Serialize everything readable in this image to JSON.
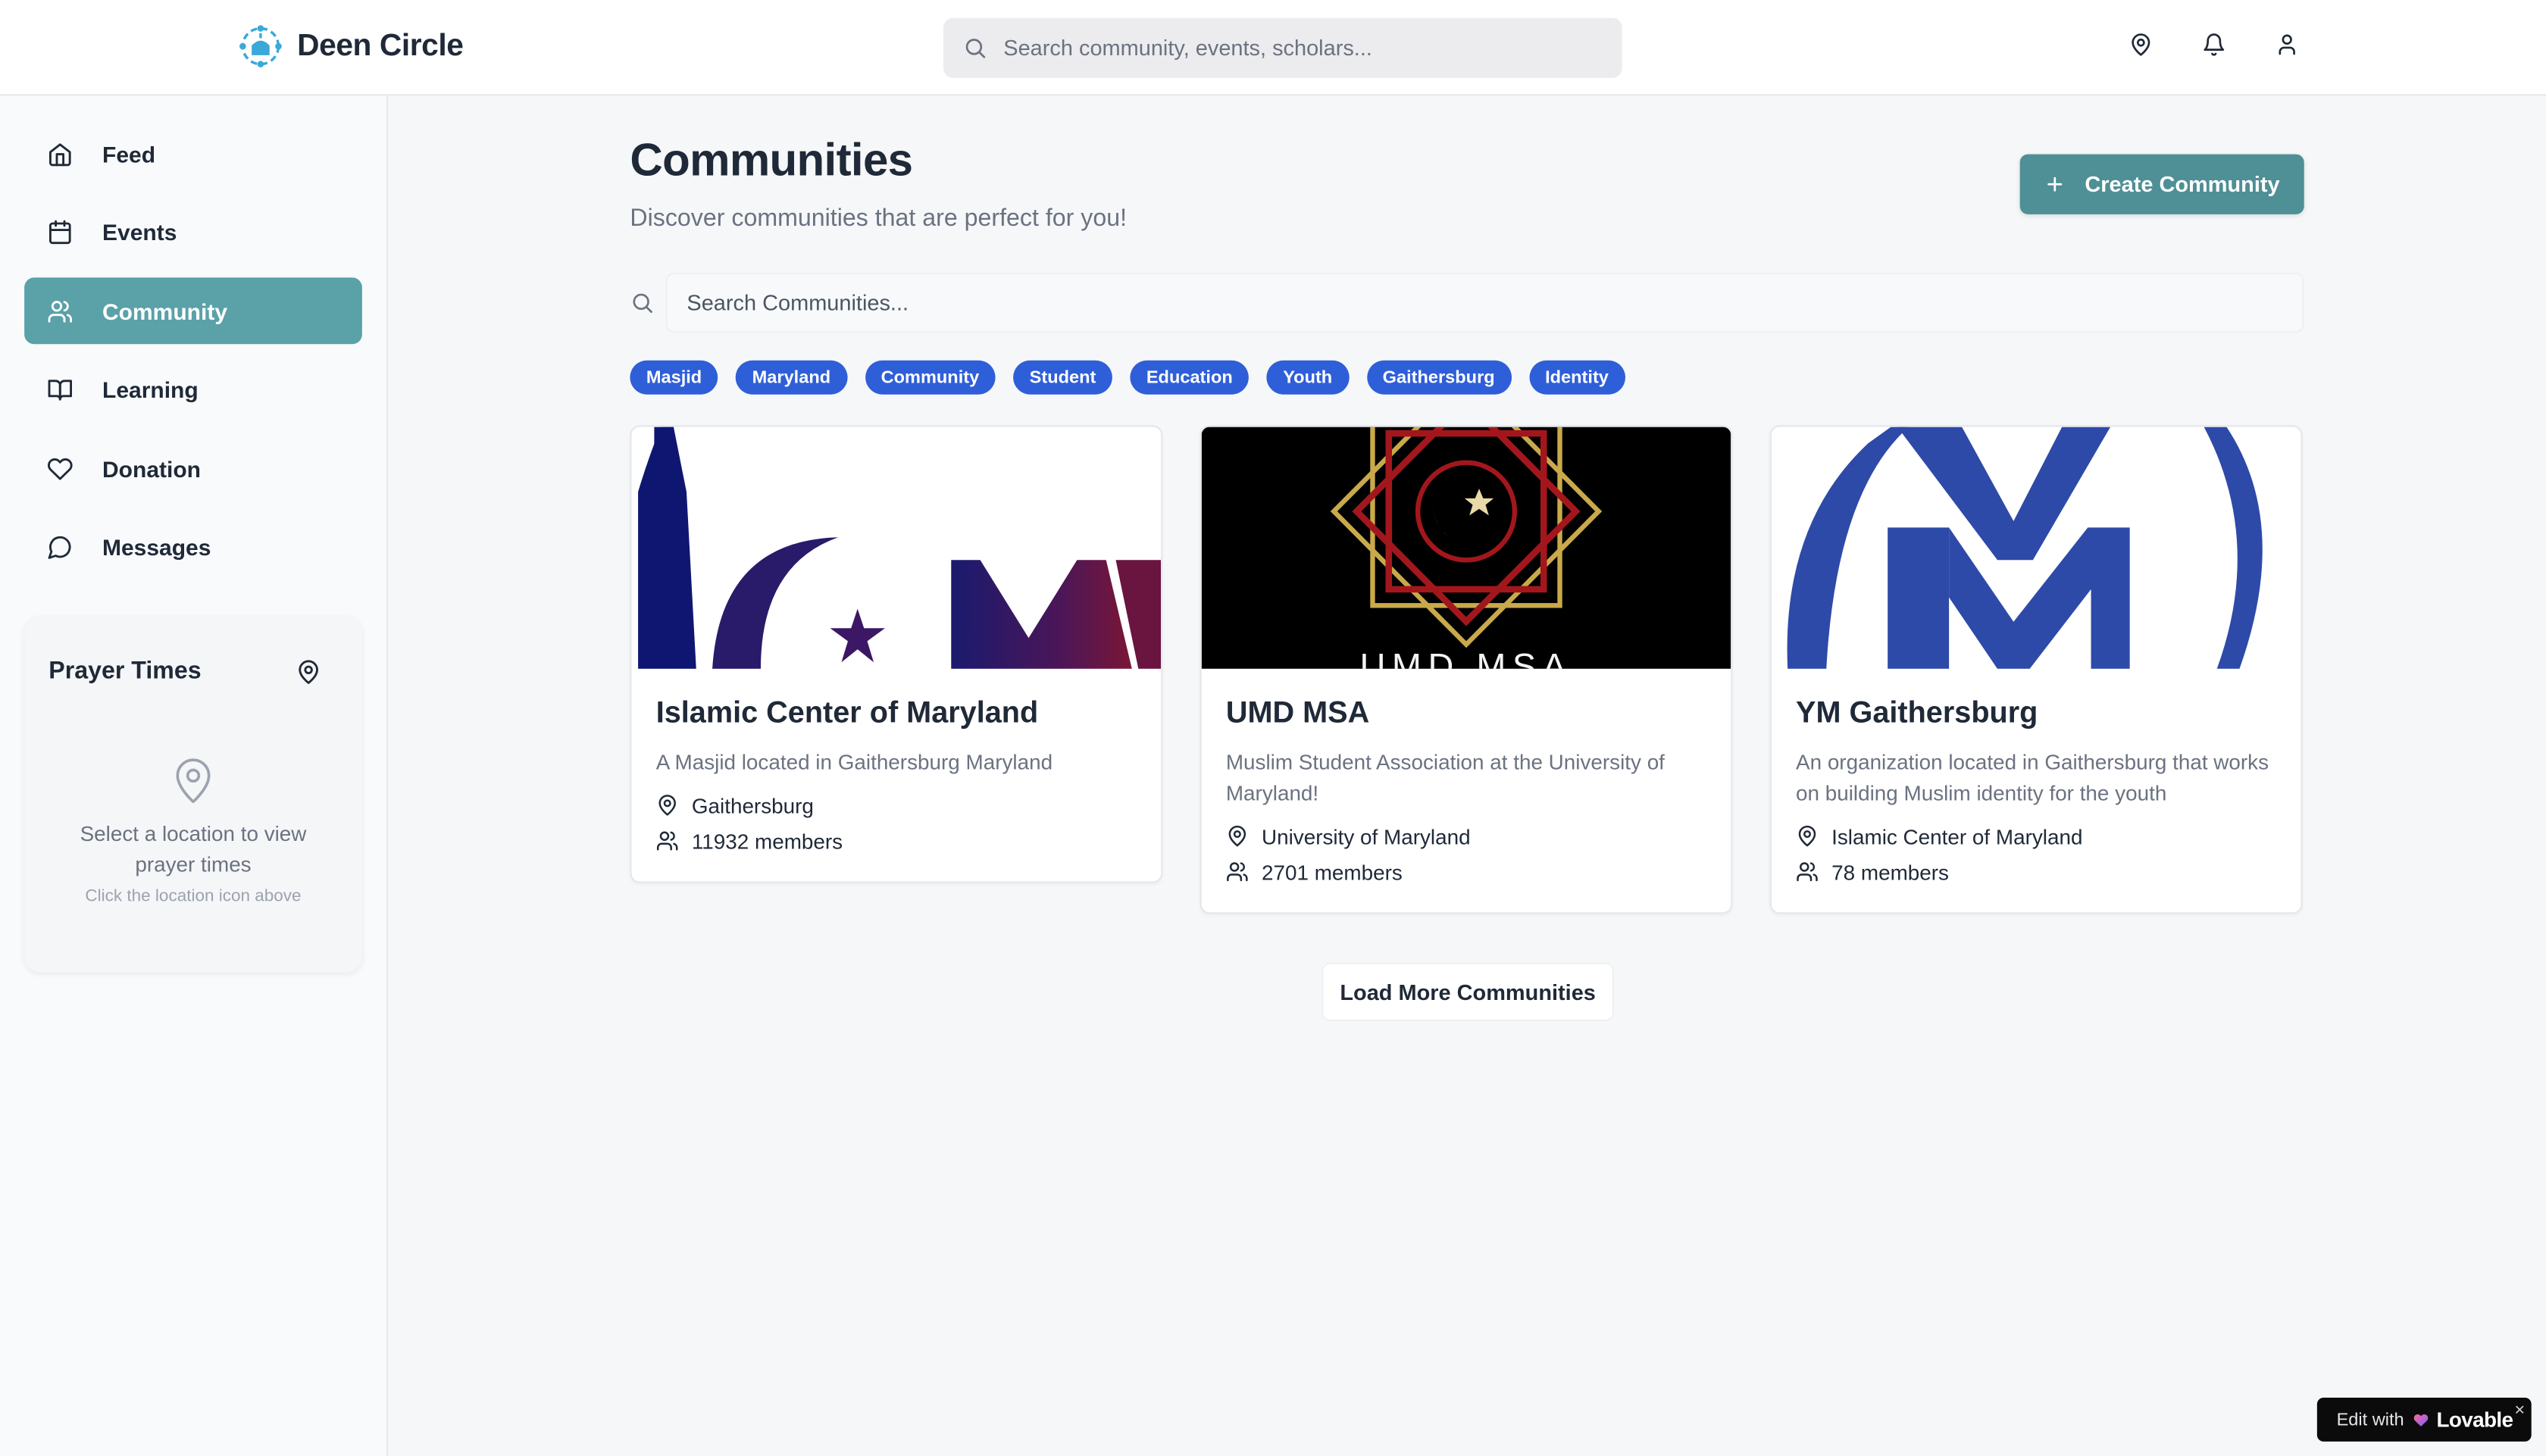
{
  "app": {
    "name": "Deen Circle",
    "search_placeholder": "Search community, events, scholars..."
  },
  "colors": {
    "accent": "#5aa1a8",
    "button": "#4f8f96",
    "tag": "#2f5fd8"
  },
  "top_icons": [
    "location-icon",
    "bell-icon",
    "user-icon"
  ],
  "sidebar": {
    "items": [
      {
        "label": "Feed",
        "icon": "home-icon",
        "active": false
      },
      {
        "label": "Events",
        "icon": "calendar-icon",
        "active": false
      },
      {
        "label": "Community",
        "icon": "users-icon",
        "active": true
      },
      {
        "label": "Learning",
        "icon": "book-icon",
        "active": false
      },
      {
        "label": "Donation",
        "icon": "heart-icon",
        "active": false
      },
      {
        "label": "Messages",
        "icon": "message-icon",
        "active": false
      }
    ],
    "prayer": {
      "title": "Prayer Times",
      "message": "Select a location to view prayer times",
      "hint": "Click the location icon above"
    }
  },
  "main": {
    "title": "Communities",
    "subtitle": "Discover communities that are perfect for you!",
    "create_label": "Create Community",
    "search_placeholder": "Search Communities...",
    "tags": [
      "Masjid",
      "Maryland",
      "Community",
      "Student",
      "Education",
      "Youth",
      "Gaithersburg",
      "Identity"
    ],
    "cards": [
      {
        "title": "Islamic Center of Maryland",
        "description": "A Masjid located in Gaithersburg Maryland",
        "location": "Gaithersburg",
        "members": "11932 members"
      },
      {
        "title": "UMD MSA",
        "description": "Muslim Student Association at the University of Maryland!",
        "location": "University of Maryland",
        "members": "2701 members",
        "thumb_text": "UMD MSA"
      },
      {
        "title": "YM Gaithersburg",
        "description": "An organization located in Gaithersburg that works on building Muslim identity for the youth",
        "location": "Islamic Center of Maryland",
        "members": "78 members"
      }
    ],
    "load_more_label": "Load More Communities"
  },
  "badge": {
    "edit": "Edit with",
    "brand": "Lovable",
    "close": "×"
  }
}
